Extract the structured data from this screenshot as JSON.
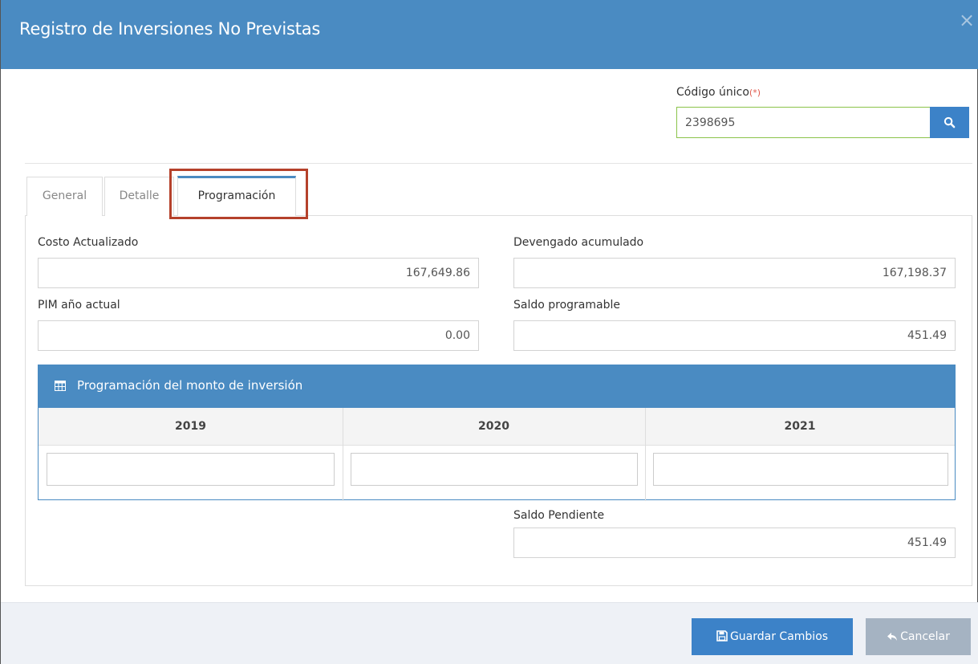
{
  "modal": {
    "title": "Registro de Inversiones No Previstas",
    "close_symbol": "×"
  },
  "codigo": {
    "label": "Código único",
    "required_mark": "(*)",
    "value": "2398695",
    "search_icon": "search-icon"
  },
  "tabs": [
    {
      "label": "General",
      "active": false
    },
    {
      "label": "Detalle",
      "active": false
    },
    {
      "label": "Programación",
      "active": true
    }
  ],
  "fields": {
    "costo_actualizado": {
      "label": "Costo Actualizado",
      "value": "167,649.86"
    },
    "devengado_acumulado": {
      "label": "Devengado acumulado",
      "value": "167,198.37"
    },
    "pim_anio_actual": {
      "label": "PIM año actual",
      "value": "0.00"
    },
    "saldo_programable": {
      "label": "Saldo programable",
      "value": "451.49"
    },
    "saldo_pendiente": {
      "label": "Saldo Pendiente",
      "value": "451.49"
    }
  },
  "programacion": {
    "title": "Programación del monto de inversión",
    "icon": "table-icon",
    "years": [
      "2019",
      "2020",
      "2021"
    ],
    "values": [
      "",
      "",
      ""
    ]
  },
  "footer": {
    "save_label": "Guardar Cambios",
    "cancel_label": "Cancelar"
  },
  "colors": {
    "header": "#4a8bc2",
    "primary_button": "#3c82c8",
    "disabled_button": "#a5b3c2",
    "highlight": "#b5412b",
    "valid_border": "#8bc34a"
  }
}
